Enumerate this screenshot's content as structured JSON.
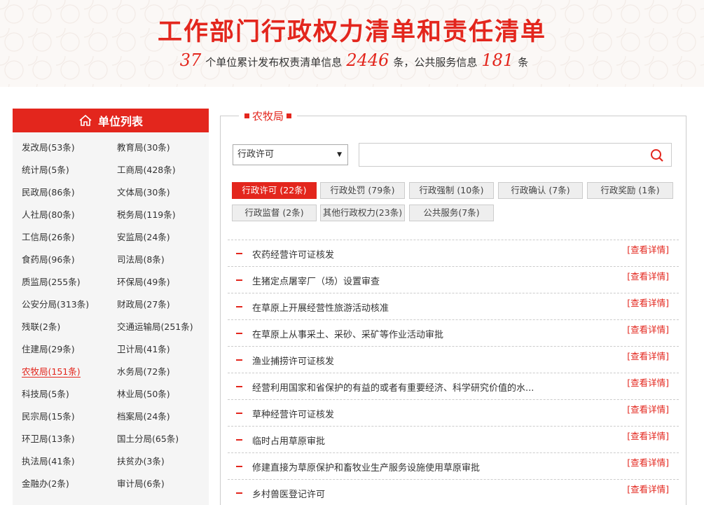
{
  "banner": {
    "title": "工作部门行政权力清单和责任清单",
    "unit_count": "37",
    "text1": "个单位累计发布权责清单信息",
    "power_count": "2446",
    "text2": "条，公共服务信息",
    "service_count": "181",
    "text3": "条"
  },
  "sidebar": {
    "title": "单位列表",
    "items": [
      "发改局(53条)",
      "教育局(30条)",
      "统计局(5条)",
      "工商局(428条)",
      "民政局(86条)",
      "文体局(30条)",
      "人社局(80条)",
      "税务局(119条)",
      "工信局(26条)",
      "安监局(24条)",
      "食药局(96条)",
      "司法局(8条)",
      "质监局(255条)",
      "环保局(49条)",
      "公安分局(313条)",
      "财政局(27条)",
      "残联(2条)",
      "交通运输局(251条)",
      "住建局(29条)",
      "卫计局(41条)",
      "农牧局(151条)",
      "水务局(72条)",
      "科技局(5条)",
      "林业局(50条)",
      "民宗局(15条)",
      "档案局(24条)",
      "环卫局(13条)",
      "国土分局(65条)",
      "执法局(41条)",
      "扶贫办(3条)",
      "金融办(2条)",
      "审计局(6条)"
    ],
    "active_index": 20
  },
  "panel": {
    "title": "农牧局",
    "select_value": "行政许可",
    "search_placeholder": "",
    "categories": [
      "行政许可 (22条)",
      "行政处罚 (79条)",
      "行政强制 (10条)",
      "行政确认 (7条)",
      "行政奖励 (1条)",
      "行政监督 (2条)",
      "其他行政权力(23条)",
      "公共服务(7条)"
    ],
    "active_category": 0,
    "detail_label": "[查看详情]",
    "items": [
      "农药经营许可证核发",
      "生猪定点屠宰厂（场）设置审查",
      "在草原上开展经营性旅游活动核准",
      "在草原上从事采土、采砂、采矿等作业活动审批",
      "渔业捕捞许可证核发",
      "经营利用国家和省保护的有益的或者有重要经济、科学研究价值的水...",
      "草种经营许可证核发",
      "临时占用草原审批",
      "修建直接为草原保护和畜牧业生产服务设施使用草原审批",
      "乡村兽医登记许可"
    ]
  },
  "colors": {
    "accent": "#e3261d"
  }
}
